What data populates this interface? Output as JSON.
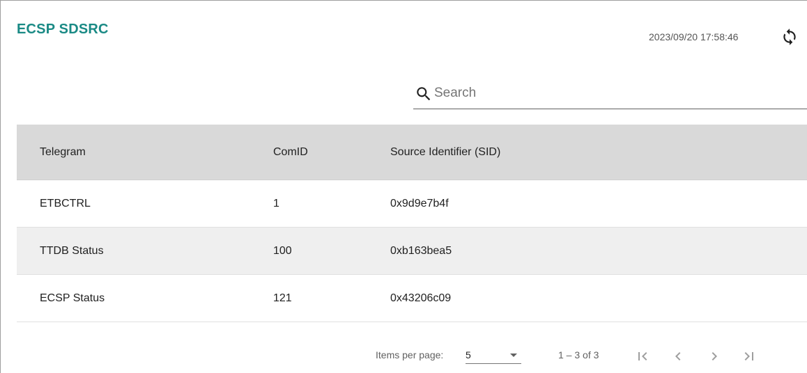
{
  "header": {
    "title": "ECSP SDSRC",
    "timestamp": "2023/09/20 17:58:46",
    "refresh_icon": "refresh-icon"
  },
  "search": {
    "placeholder": "Search",
    "value": "",
    "icon": "search-icon"
  },
  "table": {
    "columns": [
      "Telegram",
      "ComID",
      "Source Identifier (SID)"
    ],
    "rows": [
      {
        "telegram": "ETBCTRL",
        "comid": "1",
        "sid": "0x9d9e7b4f"
      },
      {
        "telegram": "TTDB Status",
        "comid": "100",
        "sid": "0xb163bea5"
      },
      {
        "telegram": "ECSP Status",
        "comid": "121",
        "sid": "0x43206c09"
      }
    ]
  },
  "paginator": {
    "items_per_page_label": "Items per page:",
    "items_per_page_value": "5",
    "range_label": "1 – 3 of 3",
    "icons": [
      "first-page-icon",
      "previous-page-icon",
      "next-page-icon",
      "last-page-icon"
    ]
  },
  "colors": {
    "title": "#1a8a85",
    "header_bg": "#d9d9d9",
    "alt_row_bg": "#efefef",
    "disabled_icon": "#9e9e9e"
  }
}
